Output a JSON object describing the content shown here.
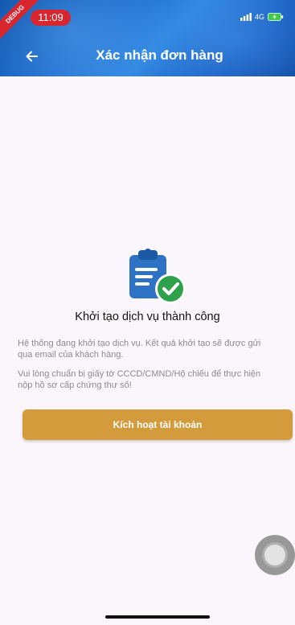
{
  "status_bar": {
    "time": "11:09",
    "network": "4G",
    "debug_label": "DEBUG"
  },
  "header": {
    "title": "Xác nhận đơn hàng"
  },
  "content": {
    "success_title": "Khởi tạo dịch vụ thành công",
    "message_1_line_1": "Hệ thống đang khởi tạo dịch vụ. Kết quả khởi tạo sẽ được gửi",
    "message_1_line_2": "qua email của khách hàng.",
    "message_2_line_1": "Vui lòng chuẩn bị giấy tờ CCCD/CMND/Hộ chiếu để thực hiện",
    "message_2_line_2": "nộp hồ sơ cấp chứng thư số!"
  },
  "actions": {
    "activate_label": "Kích hoạt tài khoản"
  },
  "colors": {
    "header_blue": "#1f6fd0",
    "button_gold": "#d49b3d",
    "success_green": "#2fa14a",
    "clipboard_blue": "#2d72c4",
    "debug_red": "#d8262e"
  },
  "icons": {
    "back": "arrow-left-icon",
    "success": "clipboard-check-icon"
  }
}
